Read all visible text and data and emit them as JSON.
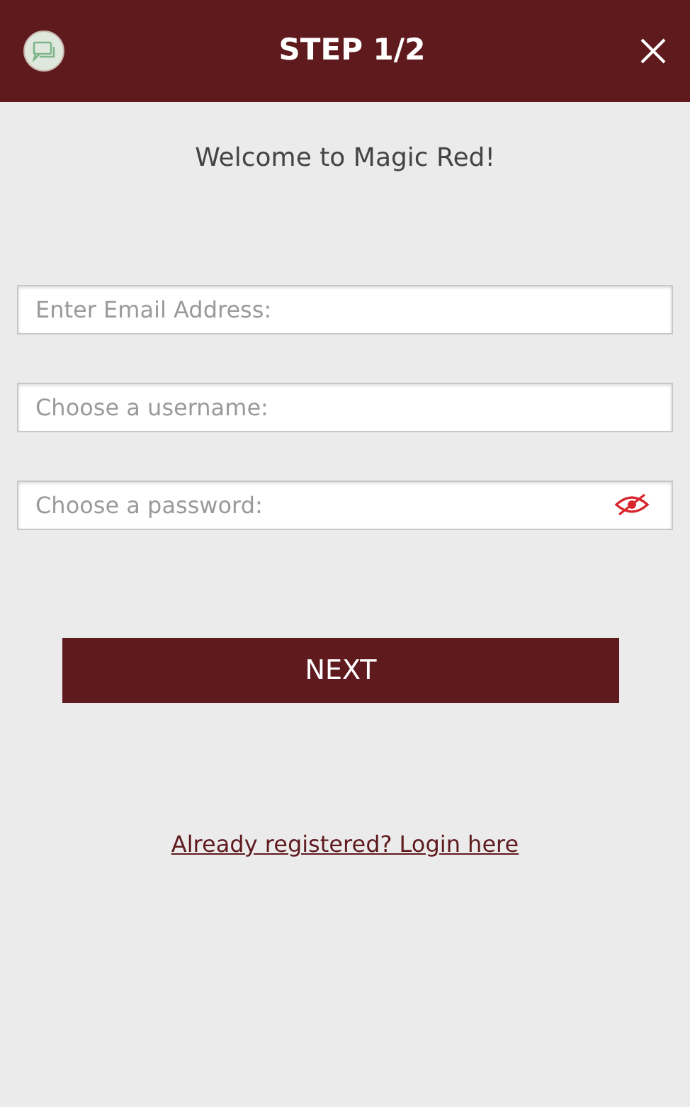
{
  "header": {
    "title": "STEP 1/2"
  },
  "welcome": "Welcome to Magic Red!",
  "fields": [
    {
      "kind": "email",
      "placeholder": "Enter Email Address:"
    },
    {
      "kind": "text",
      "placeholder": "Choose a username:"
    },
    {
      "kind": "password",
      "placeholder": "Choose a password:"
    }
  ],
  "next_button": "NEXT",
  "login_link": "Already registered? Login here"
}
